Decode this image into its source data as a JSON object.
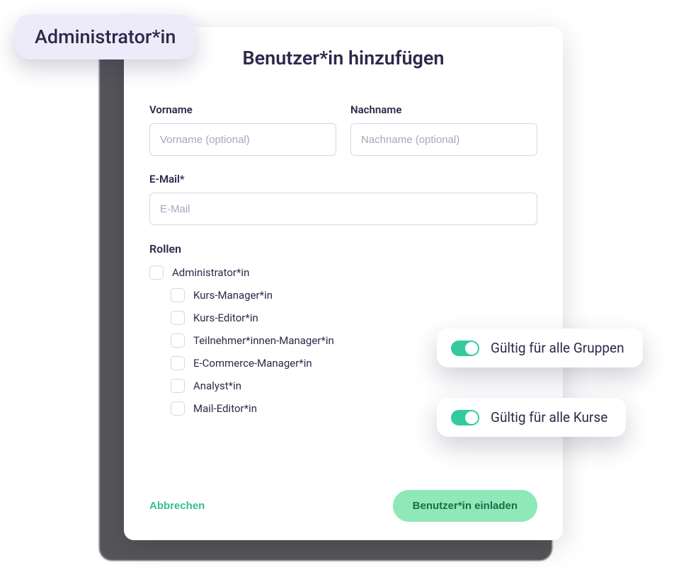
{
  "dialog": {
    "title": "Benutzer*in hinzufügen",
    "fields": {
      "firstName": {
        "label": "Vorname",
        "placeholder": "Vorname (optional)"
      },
      "lastName": {
        "label": "Nachname",
        "placeholder": "Nachname (optional)"
      },
      "email": {
        "label": "E-Mail*",
        "placeholder": "E-Mail"
      }
    },
    "rolesLabel": "Rollen",
    "roles": {
      "parent": "Administrator*in",
      "children": [
        "Kurs-Manager*in",
        "Kurs-Editor*in",
        "Teilnehmer*innen-Manager*in",
        "E-Commerce-Manager*in",
        "Analyst*in",
        "Mail-Editor*in"
      ]
    },
    "cancel": "Abbrechen",
    "invite": "Benutzer*in einladen"
  },
  "badge": "Administrator*in",
  "toggles": {
    "groups": "Gültig für alle Gruppen",
    "courses": "Gültig für alle Kurse"
  }
}
